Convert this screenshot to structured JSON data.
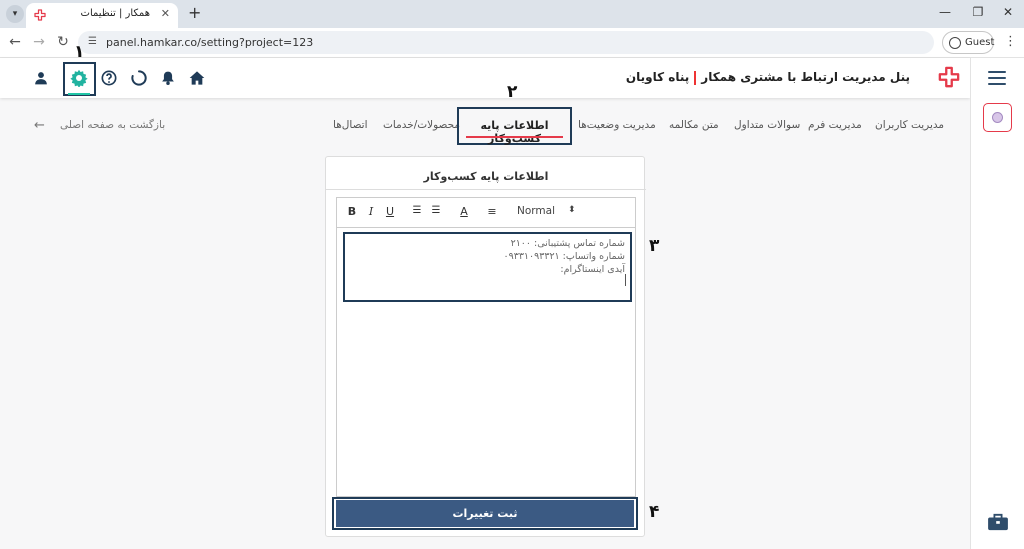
{
  "browser": {
    "tab_title": "همکار | تنظیمات",
    "url": "panel.hamkar.co/setting?project=123",
    "guest_label": "Guest"
  },
  "header": {
    "title_main": "پنل مدیریت ارتباط با مشتری همکار",
    "title_brand": "پناه کاویان",
    "accent_color": "#e53a4a",
    "brand_color": "#2f4d6b"
  },
  "annotations": {
    "n1": "١",
    "n2": "٢",
    "n3": "٣",
    "n4": "۴"
  },
  "tabs": [
    "مدیریت کاربران",
    "مدیریت فرم",
    "سوالات متداول",
    "متن مکالمه",
    "مدیریت وضعیت‌ها",
    "اطلاعات پایه کسب‌وکار",
    "محصولات/خدمات",
    "اتصال‌ها"
  ],
  "active_tab": "اطلاعات پایه کسب‌وکار",
  "back_link": "بازگشت به صفحه اصلی",
  "card": {
    "title": "اطلاعات پایه کسب‌وکار",
    "format_select": "Normal",
    "content_lines": [
      "شماره تماس پشتیبانی: ۲۱۰۰",
      "شماره واتساپ: ۰۹۳۳۱۰۹۳۳۲۱",
      "آیدی اینستاگرام:"
    ],
    "save_label": "ثبت تغییرات"
  }
}
